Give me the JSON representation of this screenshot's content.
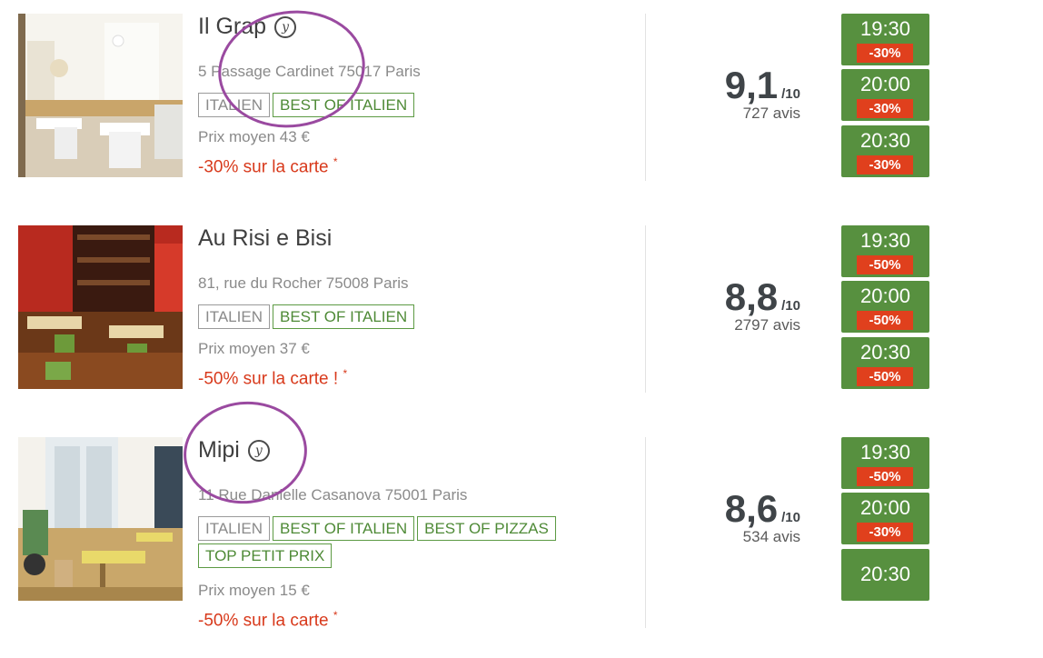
{
  "restaurants": [
    {
      "name": "Il Grap",
      "yums_icon": "yums-icon",
      "address": "5 Passage Cardinet 75017 Paris",
      "tags": [
        "ITALIEN",
        "BEST OF ITALIEN"
      ],
      "price": "Prix moyen 43 €",
      "promo": "-30% sur la carte",
      "promo_mark": "*",
      "score": "9,1",
      "scale": "/10",
      "reviews": "727 avis",
      "slots": [
        {
          "time": "19:30",
          "discount": "-30%"
        },
        {
          "time": "20:00",
          "discount": "-30%"
        },
        {
          "time": "20:30",
          "discount": "-30%"
        }
      ]
    },
    {
      "name": "Au Risi e Bisi",
      "yums_icon": "",
      "address": "81, rue du Rocher 75008 Paris",
      "tags": [
        "ITALIEN",
        "BEST OF ITALIEN"
      ],
      "price": "Prix moyen 37 €",
      "promo": "-50% sur la carte !",
      "promo_mark": "*",
      "score": "8,8",
      "scale": "/10",
      "reviews": "2797 avis",
      "slots": [
        {
          "time": "19:30",
          "discount": "-50%"
        },
        {
          "time": "20:00",
          "discount": "-50%"
        },
        {
          "time": "20:30",
          "discount": "-50%"
        }
      ]
    },
    {
      "name": "Mipi",
      "yums_icon": "yums-icon",
      "address": "11 Rue Danielle Casanova 75001 Paris",
      "tags": [
        "ITALIEN",
        "BEST OF ITALIEN",
        "BEST OF PIZZAS",
        "TOP PETIT PRIX"
      ],
      "price": "Prix moyen 15 €",
      "promo": "-50% sur la carte",
      "promo_mark": "*",
      "score": "8,6",
      "scale": "/10",
      "reviews": "534 avis",
      "slots": [
        {
          "time": "19:30",
          "discount": "-50%"
        },
        {
          "time": "20:00",
          "discount": "-30%"
        },
        {
          "time": "20:30",
          "discount": ""
        }
      ]
    }
  ],
  "yums_glyph": "y",
  "colors": {
    "slot_green": "#57903f",
    "discount_red": "#e0401d",
    "promo_red": "#d8391b",
    "best_tag_green": "#4e8a36",
    "annotation_purple": "#9a4aa0"
  }
}
